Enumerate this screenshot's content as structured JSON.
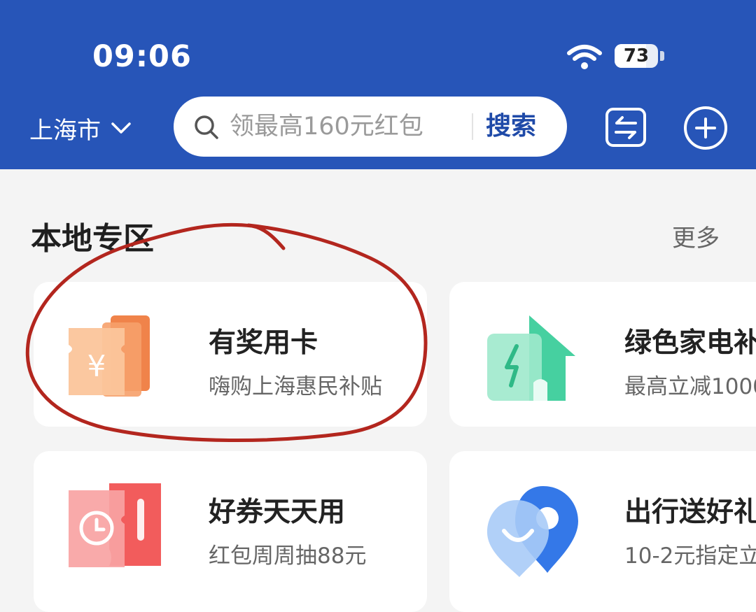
{
  "status_bar": {
    "time": "09:06",
    "battery": "73",
    "battery_level": 0.73
  },
  "header": {
    "city": "上海市",
    "search_placeholder": "领最高160元红包",
    "search_button": "搜索"
  },
  "section": {
    "title": "本地专区",
    "more": "更多"
  },
  "cards": [
    {
      "title": "有奖用卡",
      "subtitle": "嗨购上海惠民补贴",
      "icon": "ticket-yuan-icon"
    },
    {
      "title": "绿色家电补",
      "subtitle": "最高立减1000",
      "icon": "green-appliance-house-icon"
    },
    {
      "title": "好券天天用",
      "subtitle": "红包周周抽88元",
      "icon": "coupon-clock-icon"
    },
    {
      "title": "出行送好礼",
      "subtitle": "10-2元指定立",
      "icon": "location-pin-icon"
    }
  ],
  "colors": {
    "header": "#2755b8",
    "annotation": "#b3261e"
  }
}
